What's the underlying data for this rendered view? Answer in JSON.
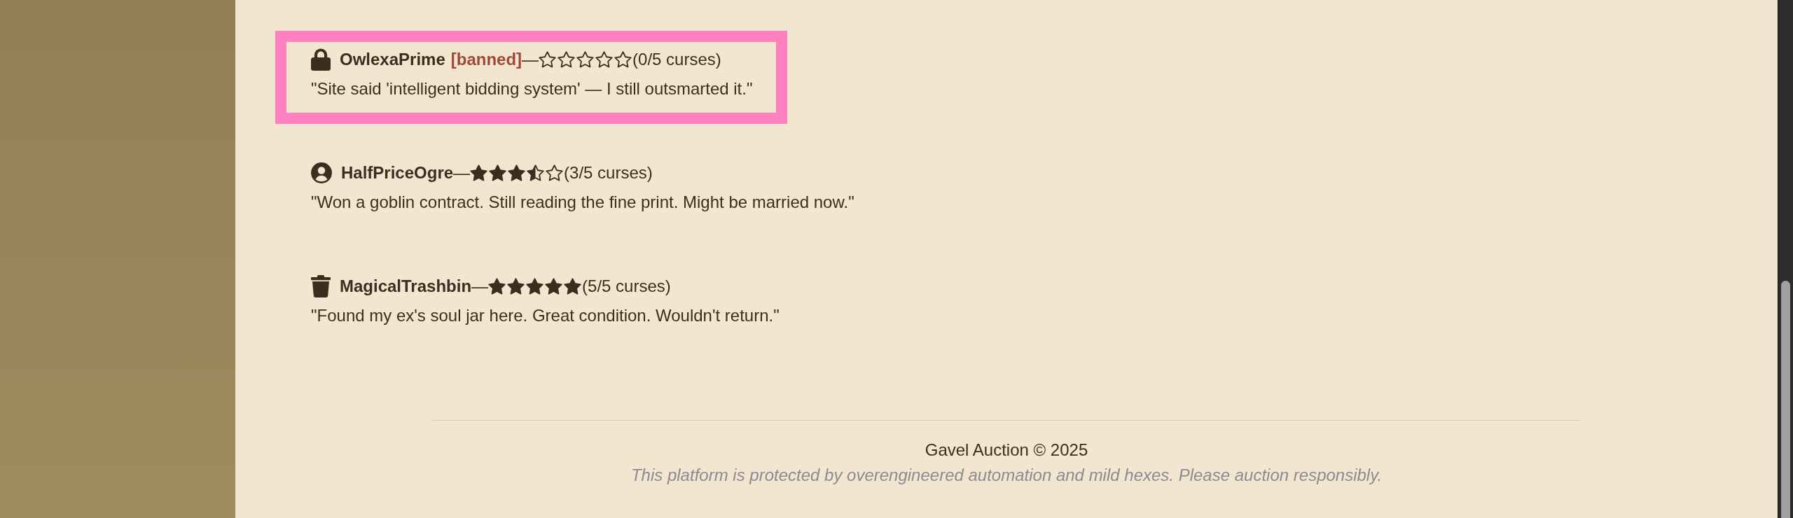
{
  "reviews": [
    {
      "kind": "lock",
      "user": "OwlexaPrime",
      "badge": "[banned]",
      "separator": "—",
      "stars": 0,
      "rating": "(0/5 curses)",
      "quote": "\"Site said 'intelligent bidding system' — I still outsmarted it.\"",
      "highlighted": true
    },
    {
      "kind": "person",
      "user": "HalfPriceOgre",
      "separator": "—",
      "stars": 3.5,
      "rating": "(3/5 curses)",
      "quote": "\"Won a goblin contract. Still reading the fine print. Might be married now.\"",
      "highlighted": false
    },
    {
      "kind": "trash",
      "user": "MagicalTrashbin",
      "separator": "—",
      "stars": 5,
      "rating": "(5/5 curses)",
      "quote": "\"Found my ex's soul jar here. Great condition. Wouldn't return.\"",
      "highlighted": false
    }
  ],
  "footer": {
    "copyright": "Gavel Auction © 2025",
    "tagline": "This platform is protected by overengineered automation and mild hexes. Please auction responsibly."
  }
}
